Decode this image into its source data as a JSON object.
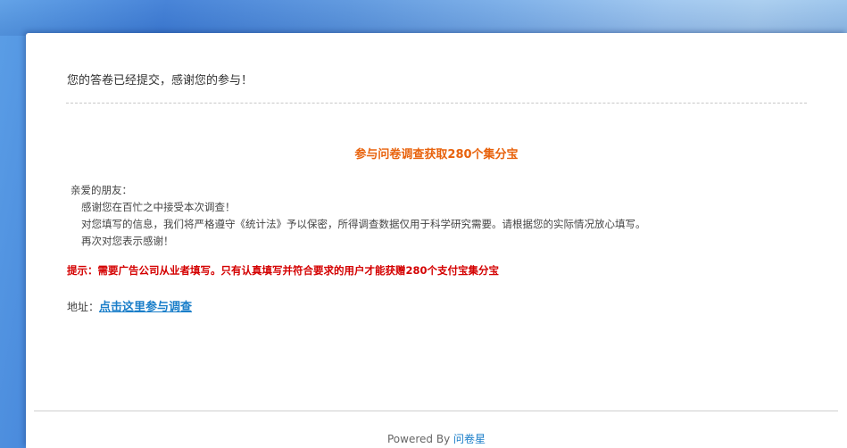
{
  "confirmation": {
    "message": "您的答卷已经提交，感谢您的参与！"
  },
  "promo": {
    "title": "参与问卷调查获取280个集分宝"
  },
  "letter": {
    "greeting": "亲爱的朋友：",
    "lines": [
      "感谢您在百忙之中接受本次调查！",
      "对您填写的信息，我们将严格遵守《统计法》予以保密，所得调查数据仅用于科学研究需要。请根据您的实际情况放心填写。",
      "再次对您表示感谢！"
    ]
  },
  "notice": {
    "text": "提示：需要广告公司从业者填写。只有认真填写并符合要求的用户才能获赠280个支付宝集分宝"
  },
  "address": {
    "label": "地址：",
    "link_text": "点击这里参与调查"
  },
  "footer": {
    "powered_by": "Powered By ",
    "brand": "问卷星"
  },
  "colors": {
    "promo_title": "#e8620c",
    "notice": "#d40000",
    "link": "#1a7ec9"
  }
}
